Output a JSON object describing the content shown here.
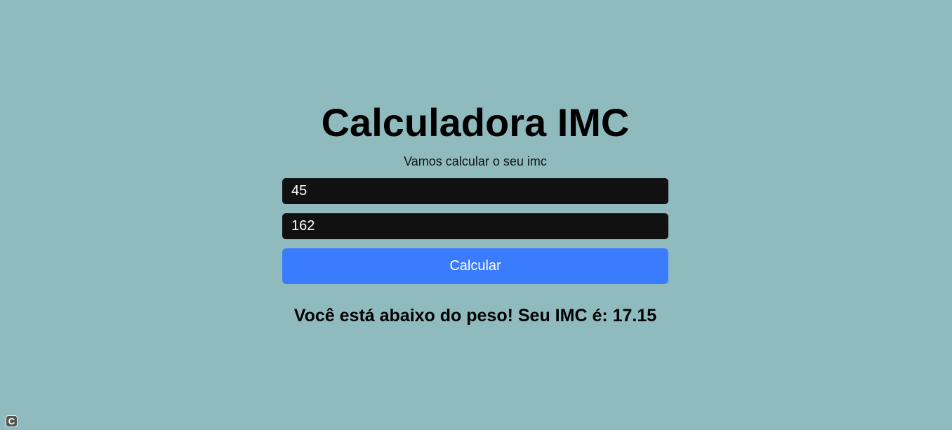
{
  "app": {
    "title": "Calculadora IMC",
    "subtitle": "Vamos calcular o seu imc"
  },
  "form": {
    "weight_value": "45",
    "height_value": "162",
    "button_label": "Calcular"
  },
  "result": {
    "text": "Você está abaixo do peso! Seu IMC é: 17.15"
  },
  "corner_badge": {
    "glyph": "C",
    "icon": "c-badge-icon"
  },
  "colors": {
    "background": "#8fbbbf",
    "input_background": "#111111",
    "button": "#3a7bff"
  }
}
